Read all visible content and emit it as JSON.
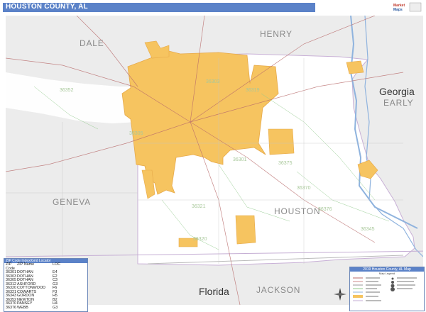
{
  "title": "HOUSTON COUNTY, AL",
  "logo": {
    "text": "MARKET MAPS",
    "name": "map-publisher-logo"
  },
  "regions": {
    "dale": "DALE",
    "henry": "HENRY",
    "georgia": "Georgia",
    "early": "EARLY",
    "geneva": "GENEVA",
    "houston": "HOUSTON",
    "florida": "Florida",
    "jackson": "JACKSON"
  },
  "zip_labels": [
    "36352",
    "36303",
    "36319",
    "36375",
    "36376",
    "36370",
    "36345",
    "36321",
    "36305",
    "36320",
    "36301"
  ],
  "zip_index": {
    "header": "ZIP Code Index/Grid Locator",
    "columns": [
      "ZIP Code",
      "ZIP Name",
      "LOC"
    ],
    "rows": [
      [
        "36301",
        "DOTHAN",
        "E4"
      ],
      [
        "36303",
        "DOTHAN",
        "E2"
      ],
      [
        "36305",
        "DOTHAN",
        "C3"
      ],
      [
        "36312",
        "ASHFORD",
        "G3"
      ],
      [
        "36320",
        "COTTONWOOD",
        "F6"
      ],
      [
        "36321",
        "COWARTS",
        "F3"
      ],
      [
        "36343",
        "GORDON",
        "H5"
      ],
      [
        "36352",
        "NEWTON",
        "B2"
      ],
      [
        "36370",
        "PANSEY",
        "H4"
      ],
      [
        "36376",
        "WEBB",
        "G3"
      ]
    ]
  },
  "legend": {
    "header": "2019 Houston County, AL Map",
    "sub": "Map Legend"
  },
  "colors": {
    "urban": "#f6c460",
    "county_bg": "#ffffff",
    "outside": "#ececec",
    "water": "#8fb3de",
    "header": "#5b82c8"
  }
}
